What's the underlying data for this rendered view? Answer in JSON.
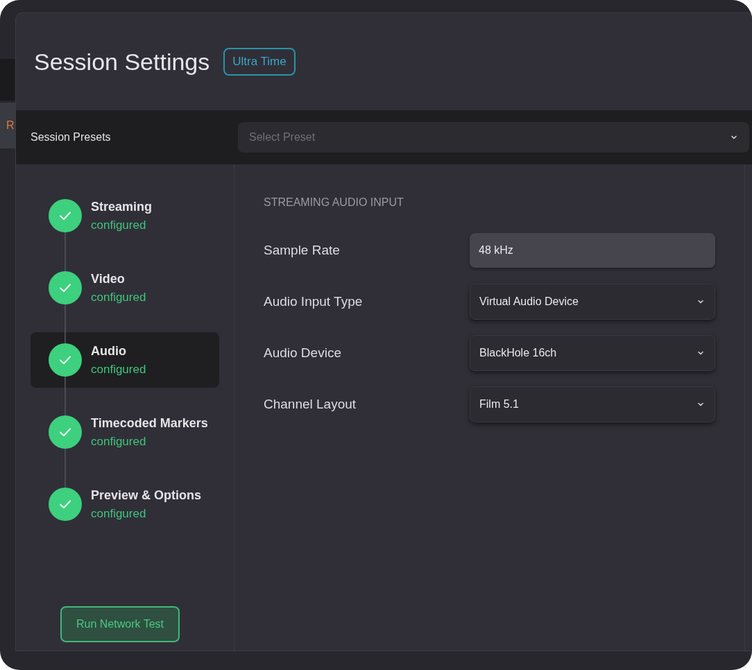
{
  "background_window": {
    "tab_label": "R"
  },
  "dialog": {
    "title": "Session Settings",
    "badge": "Ultra Time"
  },
  "presets": {
    "label": "Session Presets",
    "placeholder": "Select Preset"
  },
  "steps": [
    {
      "title": "Streaming",
      "status": "configured",
      "done": true,
      "selected": false
    },
    {
      "title": "Video",
      "status": "configured",
      "done": true,
      "selected": false
    },
    {
      "title": "Audio",
      "status": "configured",
      "done": true,
      "selected": true
    },
    {
      "title": "Timecoded Markers",
      "status": "configured",
      "done": true,
      "selected": false
    },
    {
      "title": "Preview & Options",
      "status": "configured",
      "done": true,
      "selected": false
    }
  ],
  "network_test_button": "Run Network Test",
  "section": {
    "heading": "STREAMING AUDIO INPUT",
    "fields": [
      {
        "label": "Sample Rate",
        "value": "48 kHz",
        "kind": "text"
      },
      {
        "label": "Audio Input Type",
        "value": "Virtual Audio Device",
        "kind": "select"
      },
      {
        "label": "Audio Device",
        "value": "BlackHole 16ch",
        "kind": "select"
      },
      {
        "label": "Channel Layout",
        "value": "Film 5.1",
        "kind": "select"
      }
    ]
  }
}
